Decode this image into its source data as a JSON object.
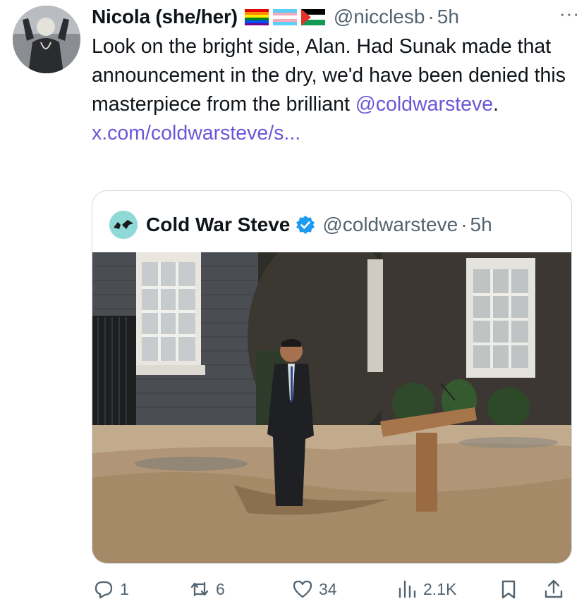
{
  "tweet": {
    "author_name": "Nicola (she/her)",
    "handle": "@nicclesb",
    "separator": "·",
    "time": "5h",
    "more_label": "···",
    "text_before": "Look on the bright side, Alan. Had Sunak made that announcement in the dry, we'd have been denied this masterpiece from the brilliant ",
    "mention": "@coldwarsteve",
    "text_after": ".",
    "url": "x.com/coldwarsteve/s..."
  },
  "quote": {
    "author_name": "Cold War Steve",
    "handle": "@coldwarsteve",
    "separator": "·",
    "time": "5h",
    "image_icon": "image-flooded-street-podium"
  },
  "actions": {
    "reply_count": "1",
    "retweet_count": "6",
    "like_count": "34",
    "views_count": "2.1K"
  },
  "colors": {
    "link": "#6b57d6",
    "secondary": "#536471",
    "verified": "#1d9bf0"
  }
}
